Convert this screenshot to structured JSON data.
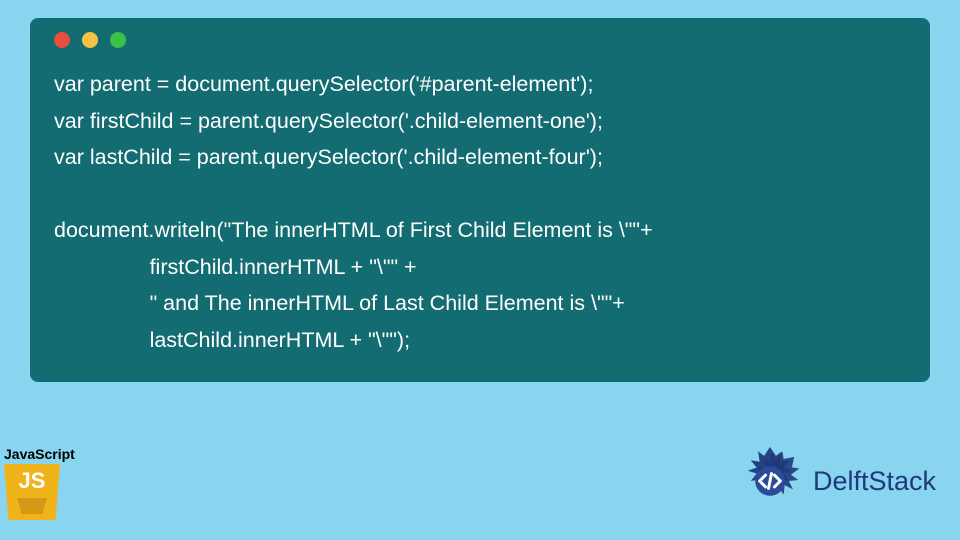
{
  "code": {
    "line1": "var parent = document.querySelector('#parent-element');",
    "line2": "var firstChild = parent.querySelector('.child-element-one');",
    "line3": "var lastChild = parent.querySelector('.child-element-four');",
    "line4": "",
    "line5": "document.writeln(\"The innerHTML of First Child Element is \\\"\"+",
    "line6": "                firstChild.innerHTML + \"\\\"\" +",
    "line7": "                \" and The innerHTML of Last Child Element is \\\"\"+",
    "line8": "                lastChild.innerHTML + \"\\\"\");"
  },
  "badge": {
    "label": "JavaScript",
    "icon_text": "JS"
  },
  "brand": {
    "name": "DelftStack"
  },
  "colors": {
    "page_bg": "#89d4ee",
    "panel_bg": "#136c71",
    "code_text": "#ffffff",
    "js_icon_bg": "#f0b41a",
    "brand_color": "#1f3a7a",
    "dot_red": "#e84e40",
    "dot_yellow": "#f7c342",
    "dot_green": "#3bc14a"
  }
}
